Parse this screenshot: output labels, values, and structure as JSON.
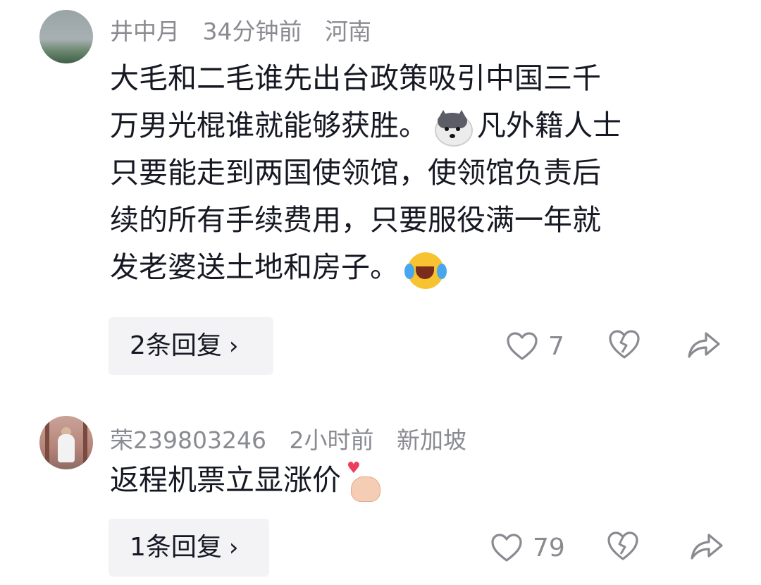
{
  "comments": [
    {
      "user": "井中月",
      "time": "34分钟前",
      "location": "河南",
      "lines": {
        "l1": "大毛和二毛谁先出台政策吸引中国三千",
        "l2a": "万男光棍谁就能够获胜。",
        "l2b": "凡外籍人士",
        "l3": "只要能走到两国使领馆，使领馆负责后",
        "l4": "续的所有手续费用，只要服役满一年就",
        "l5": "发老婆送土地和房子。"
      },
      "reply_label": "2条回复",
      "likes": "7"
    },
    {
      "user": "荣239803246",
      "time": "2小时前",
      "location": "新加坡",
      "lines": {
        "l1": "返程机票立显涨价"
      },
      "reply_label": "1条回复",
      "likes": "79"
    }
  ],
  "icons": {
    "reply_chevron": "›",
    "like": "heart-outline-icon",
    "dislike": "broken-heart-icon",
    "share": "share-arrow-icon"
  },
  "colors": {
    "text": "#161823",
    "meta": "#8a8b91",
    "reply_bg": "#f3f3f5"
  }
}
